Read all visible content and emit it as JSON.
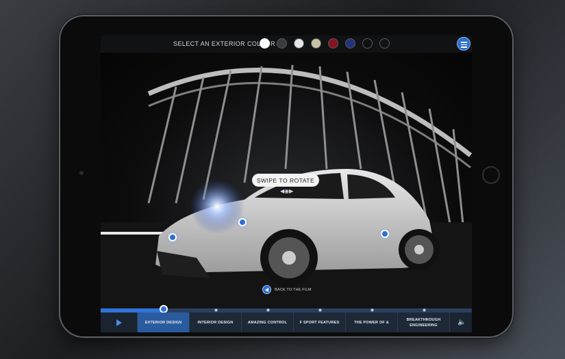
{
  "topbar": {
    "select_label": "SELECT AN EXTERIOR COLOUR",
    "swatches": [
      {
        "name": "white",
        "color": "#ffffff"
      },
      {
        "name": "dark-grey",
        "color": "#3a3a3c"
      },
      {
        "name": "light-silver",
        "color": "#e6e6e6"
      },
      {
        "name": "beige",
        "color": "#c9c2a7"
      },
      {
        "name": "red",
        "color": "#8a1220"
      },
      {
        "name": "blue",
        "color": "#22357a"
      },
      {
        "name": "black",
        "color": "#101010"
      },
      {
        "name": "black-2",
        "color": "#141414"
      }
    ],
    "menu_icon": "hamburger-icon"
  },
  "scene": {
    "swipe_label": "SWIPE TO ROTATE",
    "rotate_icon": "rotate-arrows-icon",
    "back_label": "BACK TO THE FILM",
    "back_icon": "back-arrow-icon",
    "accent_color": "#2e6fd3"
  },
  "timeline": {
    "progress": 0.17,
    "play_icon": "play-icon",
    "volume_icon": "volume-icon",
    "chapters": [
      "EXTERIOR DESIGN",
      "INTERIOR DESIGN",
      "AMAZING CONTROL",
      "F SPORT FEATURES",
      "THE POWER OF &",
      "BREAKTHROUGH\nENGINEERING"
    ],
    "active_chapter": 0
  }
}
